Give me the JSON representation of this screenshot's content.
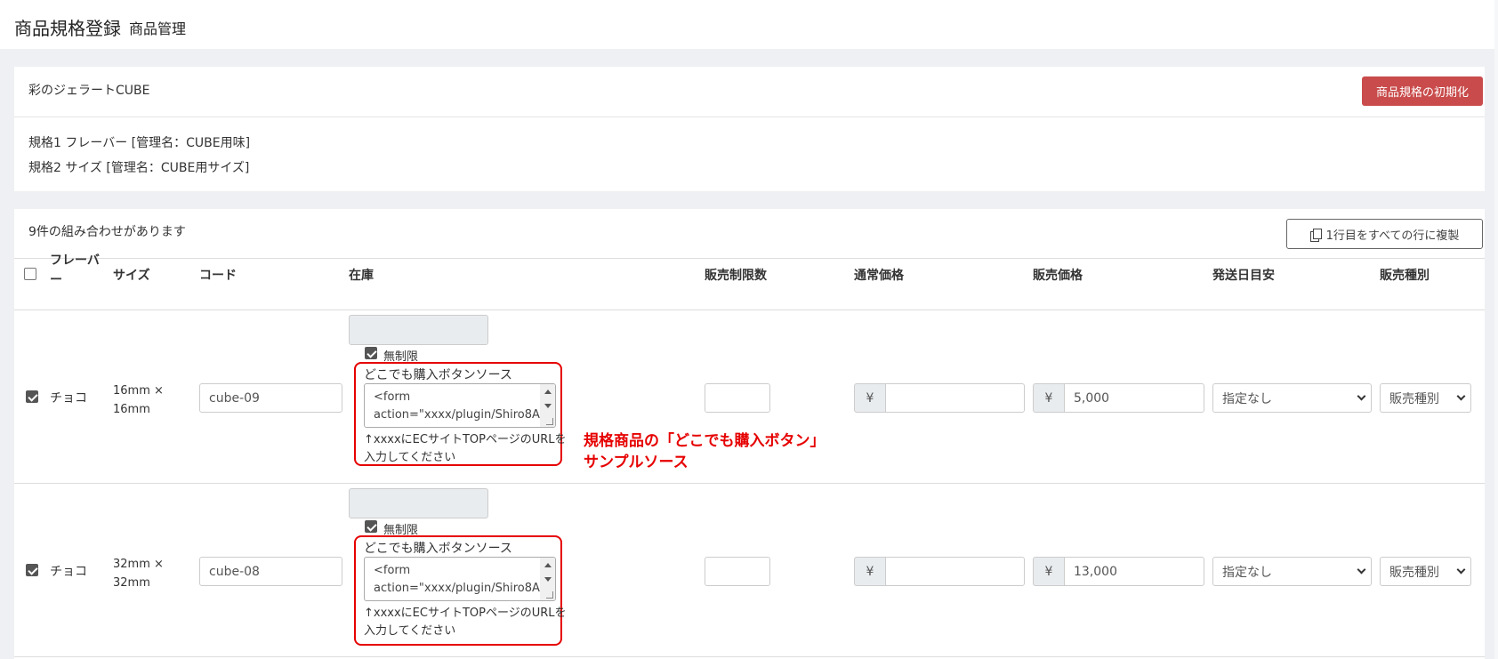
{
  "header": {
    "title": "商品規格登録",
    "subtitle": "商品管理"
  },
  "product": {
    "name": "彩のジェラートCUBE",
    "init_button": "商品規格の初期化",
    "spec1": "規格1   フレーバー [管理名：CUBE用味]",
    "spec2": "規格2   サイズ [管理名：CUBE用サイズ]"
  },
  "combinations": {
    "count_text": "9件の組み合わせがあります",
    "copy_button": "1行目をすべての行に複製"
  },
  "table": {
    "headers": {
      "flavor_line1": "フレーバ",
      "flavor_line2": "ー",
      "size": "サイズ",
      "code": "コード",
      "stock": "在庫",
      "limit": "販売制限数",
      "normal_price": "通常価格",
      "sale_price": "販売価格",
      "ship": "発送日目安",
      "sale_type": "販売種別"
    },
    "rows": [
      {
        "flavor": "チョコ",
        "size_line1": "16mm ×",
        "size_line2": "16mm",
        "code": "cube-09",
        "unlimited_label": "無制限",
        "dokodemo_label": "どこでも購入ボタンソース",
        "source_line1": "<form",
        "source_line2": "action=\"xxxx/plugin/Shiro8A",
        "note_line1": "↑xxxxにECサイトTOPページのURLを",
        "note_line2": "入力してください",
        "sale_price": "5,000",
        "ship": "指定なし",
        "sale_type": "販売種別"
      },
      {
        "flavor": "チョコ",
        "size_line1": "32mm ×",
        "size_line2": "32mm",
        "code": "cube-08",
        "unlimited_label": "無制限",
        "dokodemo_label": "どこでも購入ボタンソース",
        "source_line1": "<form",
        "source_line2": "action=\"xxxx/plugin/Shiro8A",
        "note_line1": "↑xxxxにECサイトTOPページのURLを",
        "note_line2": "入力してください",
        "sale_price": "13,000",
        "ship": "指定なし",
        "sale_type": "販売種別"
      }
    ],
    "yen": "¥"
  },
  "annotation": {
    "line1": "規格商品の「どこでも購入ボタン」",
    "line2": "サンプルソース"
  },
  "colors": {
    "danger": "#c94b4b",
    "annotation": "#e60000"
  }
}
